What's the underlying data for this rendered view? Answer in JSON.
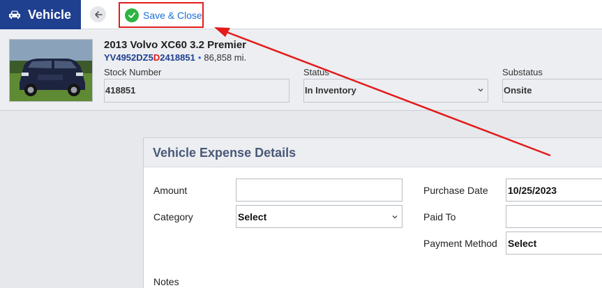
{
  "app": {
    "title": "Vehicle",
    "save_label": "Save & Close"
  },
  "vehicle": {
    "name": "2013 Volvo XC60 3.2 Premier",
    "vin_part1": "YV4952DZ5",
    "vin_highlight": "D",
    "vin_part2": "2418851",
    "separator": "•",
    "mileage": "86,858 mi.",
    "stock_number_label": "Stock Number",
    "stock_number": "418851",
    "status_label": "Status",
    "status": "In Inventory",
    "substatus_label": "Substatus",
    "substatus": "Onsite"
  },
  "expense": {
    "title": "Vehicle Expense Details",
    "amount_label": "Amount",
    "amount_value": "",
    "category_label": "Category",
    "category_value": "Select",
    "purchase_date_label": "Purchase Date",
    "purchase_date_value": "10/25/2023",
    "paid_to_label": "Paid To",
    "paid_to_value": "",
    "payment_method_label": "Payment Method",
    "payment_method_value": "Select",
    "notes_label": "Notes"
  },
  "colors": {
    "brand": "#1f3f8f",
    "link": "#1d6fd6",
    "highlight": "#e31b1b",
    "success": "#2fb344"
  },
  "icons": {
    "brand": "car-icon",
    "back": "arrow-left-icon",
    "save": "check-circle-icon",
    "select": "chevron-down-icon"
  }
}
